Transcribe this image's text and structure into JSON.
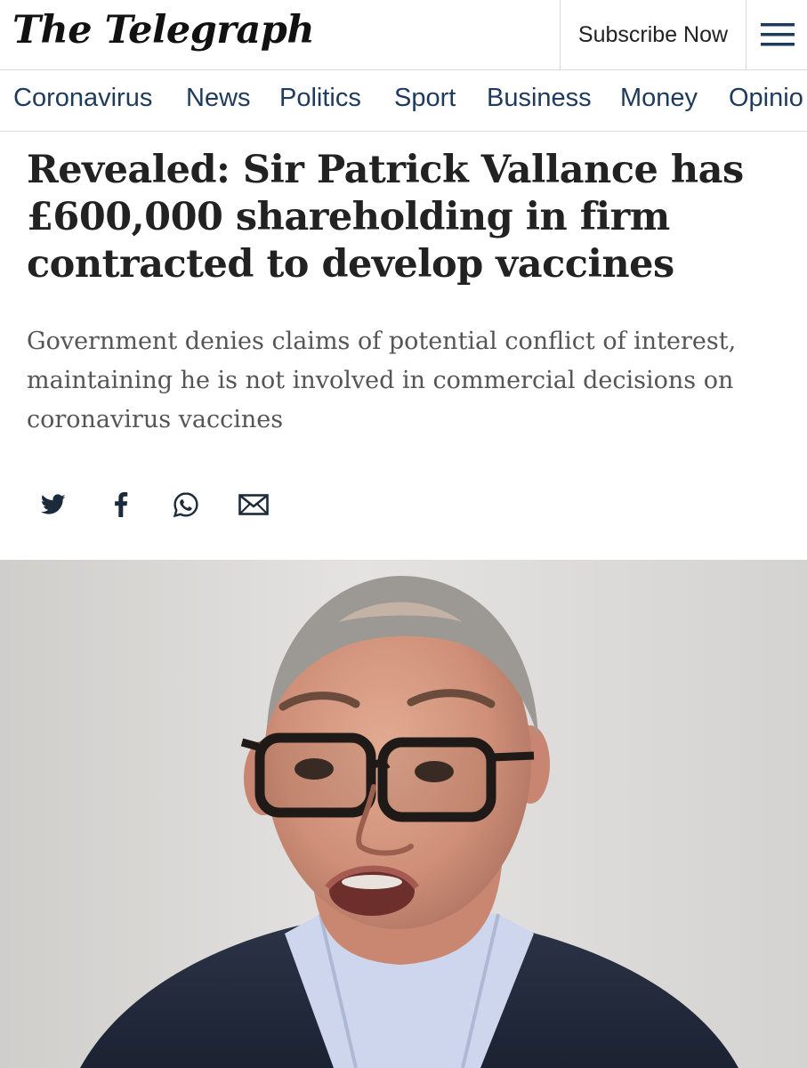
{
  "header": {
    "logo": "The Telegraph",
    "subscribe_label": "Subscribe Now",
    "menu_icon": "hamburger-icon"
  },
  "nav": {
    "items": [
      "Coronavirus",
      "News",
      "Politics",
      "Sport",
      "Business",
      "Money",
      "Opinio"
    ]
  },
  "article": {
    "headline_lines": [
      "Revealed: Sir Patrick Vallance has",
      "£600,000 shareholding in firm",
      "contracted to develop vaccines"
    ],
    "standfirst_lines": [
      "Government denies claims of potential conflict of interest,",
      "maintaining he is not involved in commercial decisions on",
      "coronavirus vaccines"
    ]
  },
  "share": {
    "icons": [
      "twitter-icon",
      "facebook-icon",
      "whatsapp-icon",
      "email-icon"
    ]
  },
  "colors": {
    "nav_text": "#1e3a5c",
    "headline": "#222222",
    "standfirst": "#555555",
    "divider": "#d9d9d9"
  }
}
